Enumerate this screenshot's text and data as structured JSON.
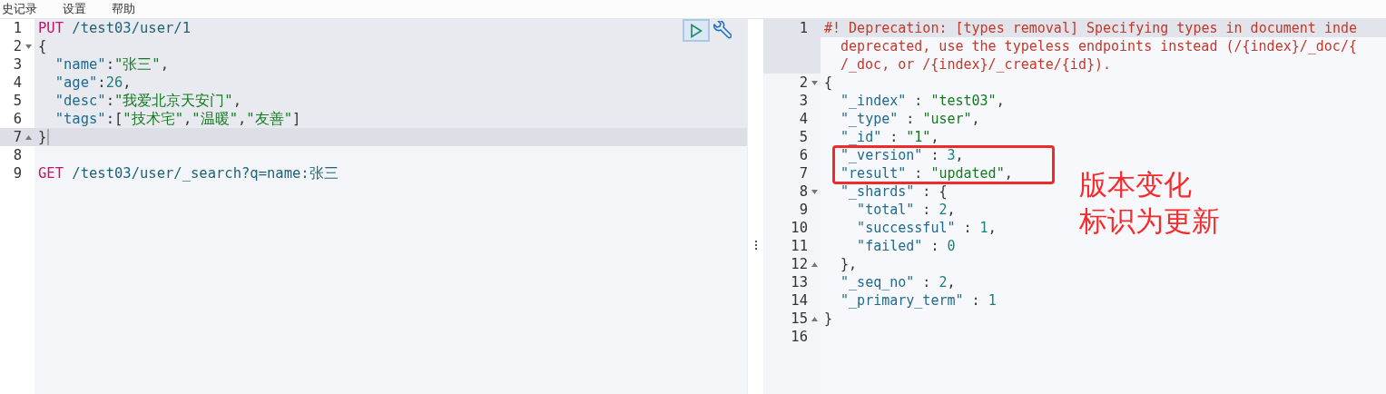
{
  "menu": [
    "史记录",
    "设置",
    "帮助"
  ],
  "request_editor": {
    "lines": [
      {
        "number": "1",
        "kind": "plain",
        "selected": true,
        "active": false,
        "tokens": [
          {
            "kind": "method",
            "text": "PUT"
          },
          {
            "kind": "url",
            "text": " /test03/user/1"
          }
        ]
      },
      {
        "number": "2",
        "kind": "fold-start",
        "selected": true,
        "active": false,
        "tokens": [
          {
            "kind": "punct",
            "text": "{"
          }
        ]
      },
      {
        "number": "3",
        "kind": "plain",
        "selected": true,
        "active": false,
        "tokens": [
          {
            "kind": "key",
            "text": "  \"name\""
          },
          {
            "kind": "punct",
            "text": ":"
          },
          {
            "kind": "string",
            "text": "\"张三\""
          },
          {
            "kind": "punct",
            "text": ","
          }
        ]
      },
      {
        "number": "4",
        "kind": "plain",
        "selected": true,
        "active": false,
        "tokens": [
          {
            "kind": "key",
            "text": "  \"age\""
          },
          {
            "kind": "punct",
            "text": ":"
          },
          {
            "kind": "number",
            "text": "26"
          },
          {
            "kind": "punct",
            "text": ","
          }
        ]
      },
      {
        "number": "5",
        "kind": "plain",
        "selected": true,
        "active": false,
        "tokens": [
          {
            "kind": "key",
            "text": "  \"desc\""
          },
          {
            "kind": "punct",
            "text": ":"
          },
          {
            "kind": "string",
            "text": "\"我爱北京天安门\""
          },
          {
            "kind": "punct",
            "text": ","
          }
        ]
      },
      {
        "number": "6",
        "kind": "plain",
        "selected": true,
        "active": false,
        "tokens": [
          {
            "kind": "key",
            "text": "  \"tags\""
          },
          {
            "kind": "punct",
            "text": ":["
          },
          {
            "kind": "string",
            "text": "\"技术宅\""
          },
          {
            "kind": "punct",
            "text": ","
          },
          {
            "kind": "string",
            "text": "\"温暖\""
          },
          {
            "kind": "punct",
            "text": ","
          },
          {
            "kind": "string",
            "text": "\"友善\""
          },
          {
            "kind": "punct",
            "text": "]"
          }
        ]
      },
      {
        "number": "7",
        "kind": "fold-end",
        "selected": true,
        "active": true,
        "tokens": [
          {
            "kind": "punct",
            "text": "}"
          }
        ]
      },
      {
        "number": "8",
        "kind": "plain",
        "selected": false,
        "active": false
      },
      {
        "number": "9",
        "kind": "plain",
        "selected": false,
        "active": false,
        "tokens": [
          {
            "kind": "method",
            "text": "GET"
          },
          {
            "kind": "url",
            "text": " /test03/user/_search?q=name:张三"
          }
        ]
      }
    ]
  },
  "response_viewer": {
    "lines": [
      {
        "number": "1",
        "kind": "plain",
        "active": true,
        "tokens": [
          {
            "kind": "comment",
            "text": "#! Deprecation: [types removal] Specifying types in document inde"
          }
        ],
        "continuation": [
          "deprecated, use the typeless endpoints instead (/{index}/_doc/{",
          "/_doc, or /{index}/_create/{id})."
        ]
      },
      {
        "number": "2",
        "kind": "fold-start",
        "active": false,
        "tokens": [
          {
            "kind": "punct",
            "text": "{"
          }
        ]
      },
      {
        "number": "3",
        "kind": "plain",
        "active": false,
        "tokens": [
          {
            "kind": "key",
            "text": "  \"_index\""
          },
          {
            "kind": "punct",
            "text": " : "
          },
          {
            "kind": "string",
            "text": "\"test03\""
          },
          {
            "kind": "punct",
            "text": ","
          }
        ]
      },
      {
        "number": "4",
        "kind": "plain",
        "active": false,
        "tokens": [
          {
            "kind": "key",
            "text": "  \"_type\""
          },
          {
            "kind": "punct",
            "text": " : "
          },
          {
            "kind": "string",
            "text": "\"user\""
          },
          {
            "kind": "punct",
            "text": ","
          }
        ]
      },
      {
        "number": "5",
        "kind": "plain",
        "active": false,
        "tokens": [
          {
            "kind": "key",
            "text": "  \"_id\""
          },
          {
            "kind": "punct",
            "text": " : "
          },
          {
            "kind": "string",
            "text": "\"1\""
          },
          {
            "kind": "punct",
            "text": ","
          }
        ]
      },
      {
        "number": "6",
        "kind": "plain",
        "active": false,
        "tokens": [
          {
            "kind": "key",
            "text": "  \"_version\""
          },
          {
            "kind": "punct",
            "text": " : "
          },
          {
            "kind": "number",
            "text": "3"
          },
          {
            "kind": "punct",
            "text": ","
          }
        ]
      },
      {
        "number": "7",
        "kind": "plain",
        "active": false,
        "tokens": [
          {
            "kind": "key",
            "text": "  \"result\""
          },
          {
            "kind": "punct",
            "text": " : "
          },
          {
            "kind": "string",
            "text": "\"updated\""
          },
          {
            "kind": "punct",
            "text": ","
          }
        ]
      },
      {
        "number": "8",
        "kind": "fold-start",
        "active": false,
        "tokens": [
          {
            "kind": "key",
            "text": "  \"_shards\""
          },
          {
            "kind": "punct",
            "text": " : {"
          }
        ]
      },
      {
        "number": "9",
        "kind": "plain",
        "active": false,
        "tokens": [
          {
            "kind": "key",
            "text": "    \"total\""
          },
          {
            "kind": "punct",
            "text": " : "
          },
          {
            "kind": "number",
            "text": "2"
          },
          {
            "kind": "punct",
            "text": ","
          }
        ]
      },
      {
        "number": "10",
        "kind": "plain",
        "active": false,
        "tokens": [
          {
            "kind": "key",
            "text": "    \"successful\""
          },
          {
            "kind": "punct",
            "text": " : "
          },
          {
            "kind": "number",
            "text": "1"
          },
          {
            "kind": "punct",
            "text": ","
          }
        ]
      },
      {
        "number": "11",
        "kind": "plain",
        "active": false,
        "tokens": [
          {
            "kind": "key",
            "text": "    \"failed\""
          },
          {
            "kind": "punct",
            "text": " : "
          },
          {
            "kind": "number",
            "text": "0"
          }
        ]
      },
      {
        "number": "12",
        "kind": "fold-end",
        "active": false,
        "tokens": [
          {
            "kind": "punct",
            "text": "  },"
          }
        ]
      },
      {
        "number": "13",
        "kind": "plain",
        "active": false,
        "tokens": [
          {
            "kind": "key",
            "text": "  \"_seq_no\""
          },
          {
            "kind": "punct",
            "text": " : "
          },
          {
            "kind": "number",
            "text": "2"
          },
          {
            "kind": "punct",
            "text": ","
          }
        ]
      },
      {
        "number": "14",
        "kind": "plain",
        "active": false,
        "tokens": [
          {
            "kind": "key",
            "text": "  \"_primary_term\""
          },
          {
            "kind": "punct",
            "text": " : "
          },
          {
            "kind": "number",
            "text": "1"
          }
        ]
      },
      {
        "number": "15",
        "kind": "fold-end",
        "active": false,
        "tokens": [
          {
            "kind": "punct",
            "text": "}"
          }
        ]
      },
      {
        "number": "16",
        "kind": "plain",
        "active": false
      }
    ]
  },
  "annotation": {
    "lines": [
      "版本变化",
      "标识为更新"
    ]
  }
}
